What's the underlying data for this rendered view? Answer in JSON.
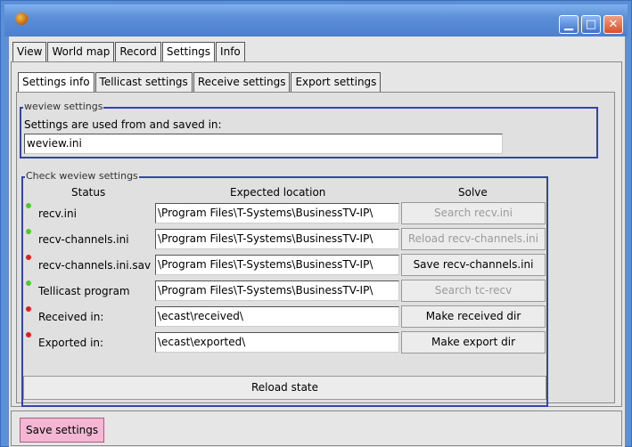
{
  "window": {
    "minimize_glyph": "▁",
    "maximize_glyph": "□",
    "close_glyph": "✕"
  },
  "main_tabs": [
    {
      "label": "View",
      "active": false
    },
    {
      "label": "World map",
      "active": false
    },
    {
      "label": "Record",
      "active": false
    },
    {
      "label": "Settings",
      "active": true
    },
    {
      "label": "Info",
      "active": false
    }
  ],
  "settings_tabs": [
    {
      "label": "Settings info",
      "active": true
    },
    {
      "label": "Tellicast settings",
      "active": false
    },
    {
      "label": "Receive settings",
      "active": false
    },
    {
      "label": "Export settings",
      "active": false
    }
  ],
  "weview_group": {
    "title": "weview settings",
    "description": "Settings are used from and saved in:",
    "ini_file": "weview.ini"
  },
  "check_group": {
    "title": "Check weview settings",
    "headers": {
      "status": "Status",
      "expected": "Expected location",
      "solve": "Solve"
    },
    "rows": [
      {
        "status": "ok",
        "label": "recv.ini",
        "location": "\\Program Files\\T-Systems\\BusinessTV-IP\\",
        "action": "Search recv.ini",
        "action_enabled": false
      },
      {
        "status": "ok",
        "label": "recv-channels.ini",
        "location": "\\Program Files\\T-Systems\\BusinessTV-IP\\",
        "action": "Reload recv-channels.ini",
        "action_enabled": false
      },
      {
        "status": "error",
        "label": "recv-channels.ini.sav",
        "location": "\\Program Files\\T-Systems\\BusinessTV-IP\\",
        "action": "Save recv-channels.ini",
        "action_enabled": true
      },
      {
        "status": "ok",
        "label": "Tellicast program",
        "location": "\\Program Files\\T-Systems\\BusinessTV-IP\\",
        "action": "Search tc-recv",
        "action_enabled": false
      },
      {
        "status": "error",
        "label": "Received in:",
        "location": "\\ecast\\received\\",
        "action": "Make received dir",
        "action_enabled": true
      },
      {
        "status": "error",
        "label": "Exported in:",
        "location": "\\ecast\\exported\\",
        "action": "Make export dir",
        "action_enabled": true
      }
    ],
    "reload_label": "Reload state"
  },
  "footer": {
    "save_label": "Save settings"
  },
  "colors": {
    "status_ok": "#4ccc2a",
    "status_error": "#e02020",
    "save_button": "#f4b6d2",
    "group_border": "#3344aa"
  }
}
